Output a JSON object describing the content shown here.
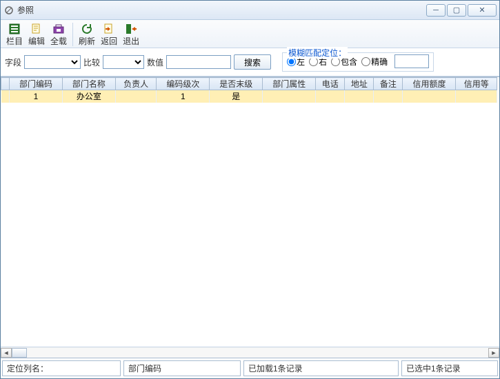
{
  "window": {
    "title": "参照"
  },
  "toolbar": {
    "col_label": "栏目",
    "edit_label": "编辑",
    "loadall_label": "全载",
    "refresh_label": "刷新",
    "back_label": "返回",
    "exit_label": "退出"
  },
  "search": {
    "field_label": "字段",
    "compare_label": "比较",
    "value_label": "数值",
    "search_btn": "搜索",
    "fuzzy_legend": "模糊匹配定位：",
    "opt_left": "左",
    "opt_right": "右",
    "opt_contain": "包含",
    "opt_exact": "精确"
  },
  "columns": [
    "部门编码",
    "部门名称",
    "负责人",
    "编码级次",
    "是否末级",
    "部门属性",
    "电话",
    "地址",
    "备注",
    "信用额度",
    "信用等"
  ],
  "rows": [
    {
      "dept_code": "1",
      "dept_name": "办公室",
      "manager": "",
      "level": "1",
      "is_leaf": "是",
      "attr": "",
      "phone": "",
      "addr": "",
      "remark": "",
      "credit": "",
      "grade": ""
    }
  ],
  "status": {
    "loc_col_label": "定位列名：",
    "loc_col_value": "部门编码",
    "loaded": "已加载1条记录",
    "selected": "已选中1条记录"
  }
}
